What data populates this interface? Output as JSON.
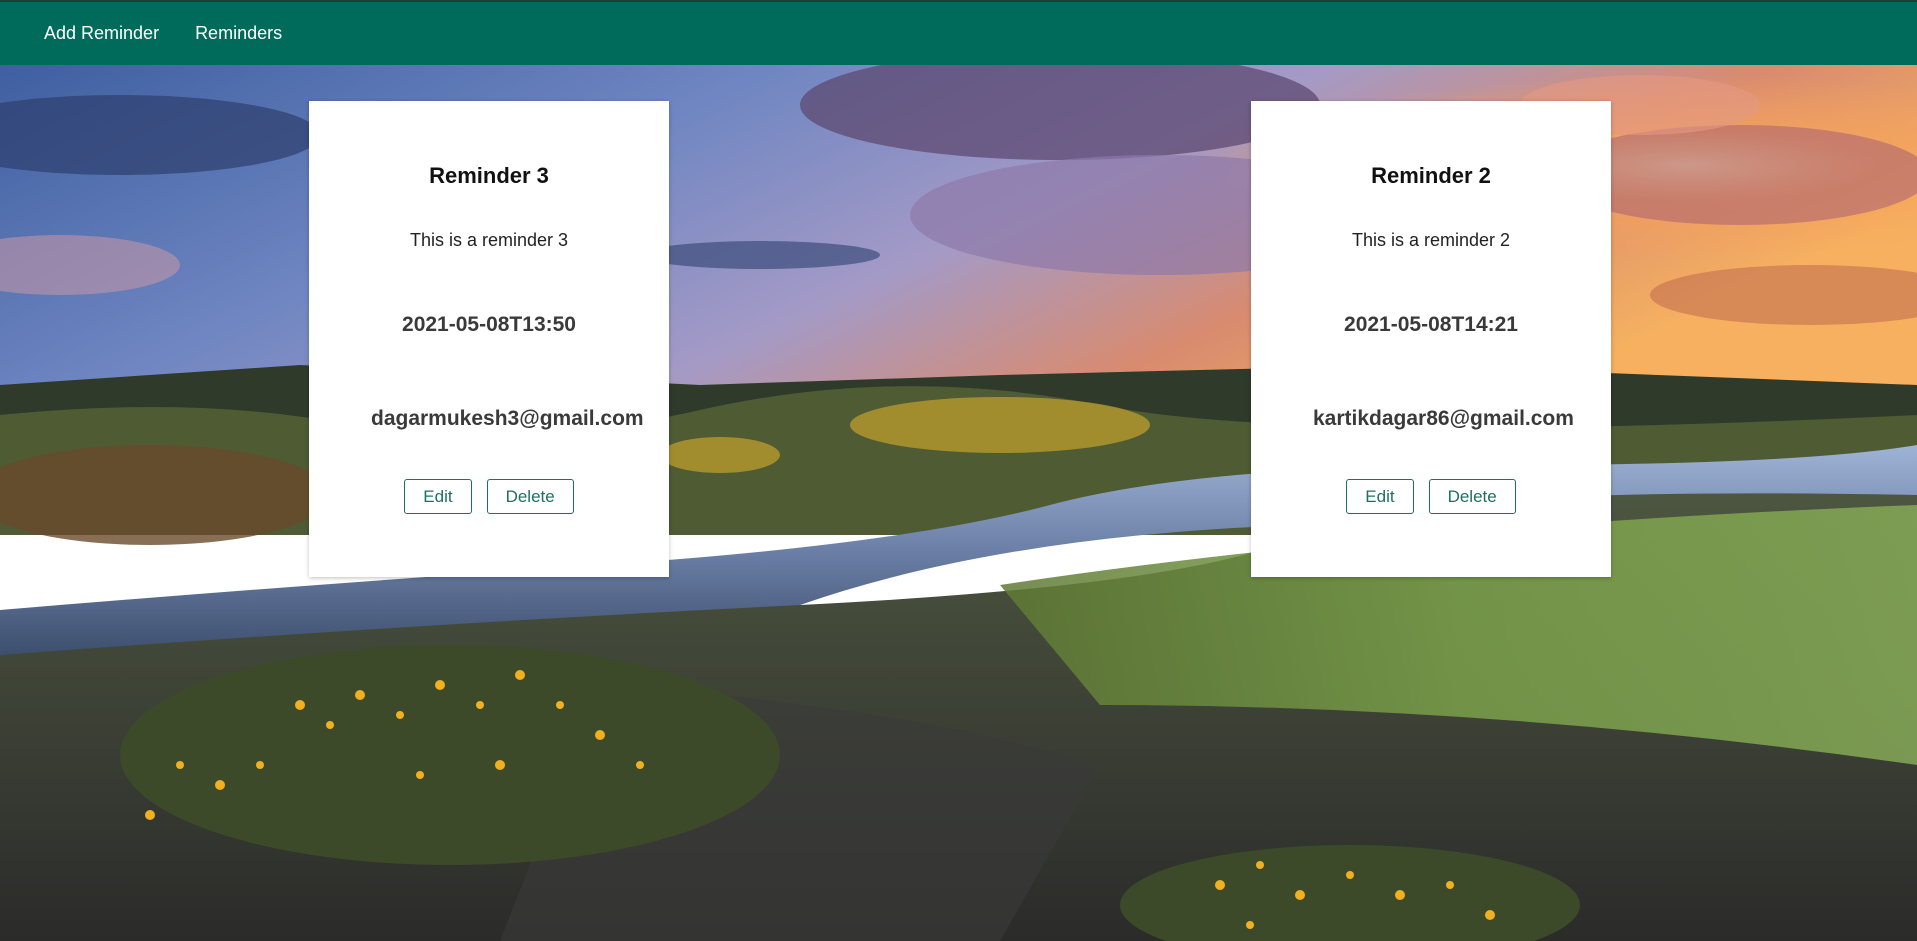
{
  "nav": {
    "items": [
      {
        "label": "Add Reminder"
      },
      {
        "label": "Reminders"
      }
    ]
  },
  "reminders": [
    {
      "title": "Reminder 3",
      "description": "This is a reminder 3",
      "datetime": "2021-05-08T13:50",
      "email": "dagarmukesh3@gmail.com",
      "edit_label": "Edit",
      "delete_label": "Delete"
    },
    {
      "title": "Reminder 2",
      "description": "This is a reminder 2",
      "datetime": "2021-05-08T14:21",
      "email": "kartikdagar86@gmail.com",
      "edit_label": "Edit",
      "delete_label": "Delete"
    }
  ],
  "colors": {
    "navbar": "#006b5a",
    "button_border": "#1f6f62",
    "card_background": "#ffffff"
  }
}
